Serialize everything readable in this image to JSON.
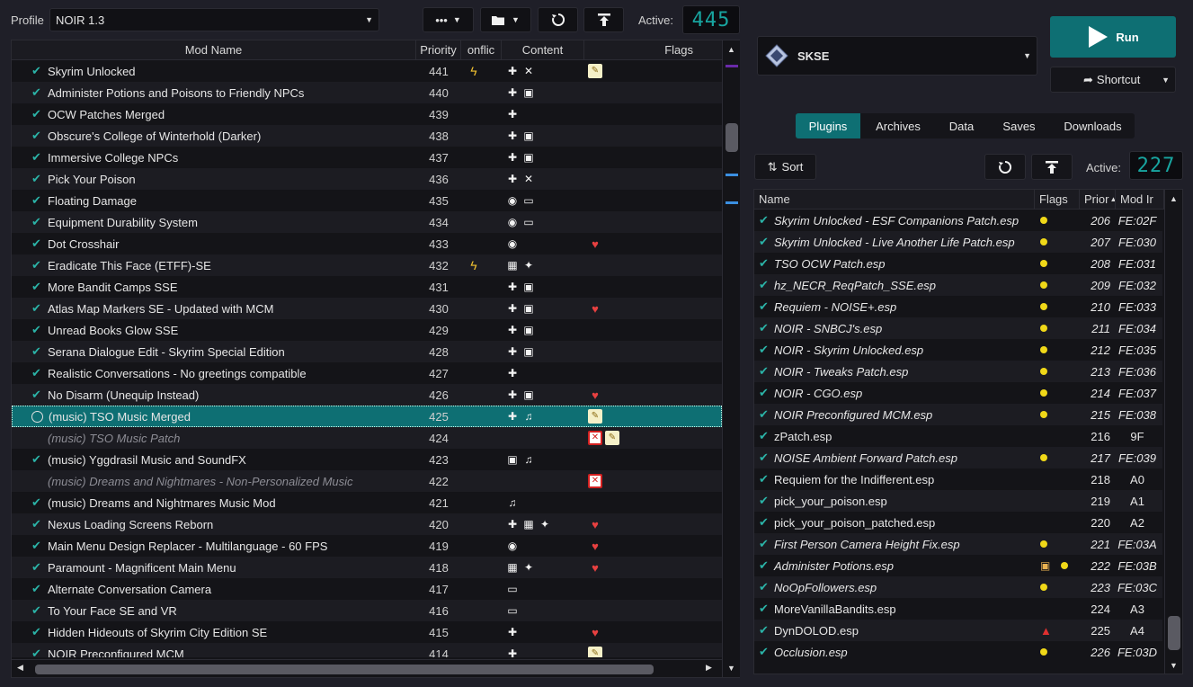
{
  "toolbar": {
    "profile_label": "Profile",
    "profile_value": "NOIR 1.3",
    "more_label": "•••",
    "active_label": "Active:",
    "active_count": "445"
  },
  "modlist": {
    "headers": [
      "Mod Name",
      "Priority",
      "onflic",
      "Content",
      "Flags"
    ],
    "rows": [
      {
        "state": "checked",
        "name": "Skyrim Unlocked",
        "priority": "441",
        "conflict": "bolt",
        "content": [
          "puzzle",
          "tools"
        ],
        "flags": [
          "note"
        ]
      },
      {
        "state": "checked",
        "name": "Administer Potions and Poisons to Friendly NPCs",
        "priority": "440",
        "conflict": "",
        "content": [
          "puzzle",
          "box"
        ],
        "flags": []
      },
      {
        "state": "checked",
        "name": "OCW Patches Merged",
        "priority": "439",
        "conflict": "",
        "content": [
          "puzzle"
        ],
        "flags": []
      },
      {
        "state": "checked",
        "name": "Obscure's College of Winterhold (Darker)",
        "priority": "438",
        "conflict": "",
        "content": [
          "puzzle",
          "box"
        ],
        "flags": []
      },
      {
        "state": "checked",
        "name": "Immersive College NPCs",
        "priority": "437",
        "conflict": "",
        "content": [
          "puzzle",
          "box"
        ],
        "flags": []
      },
      {
        "state": "checked",
        "name": "Pick Your Poison",
        "priority": "436",
        "conflict": "",
        "content": [
          "puzzle",
          "tools"
        ],
        "flags": []
      },
      {
        "state": "checked",
        "name": "Floating Damage",
        "priority": "435",
        "conflict": "",
        "content": [
          "skse",
          "ui"
        ],
        "flags": []
      },
      {
        "state": "checked",
        "name": "Equipment Durability System",
        "priority": "434",
        "conflict": "",
        "content": [
          "skse",
          "ui"
        ],
        "flags": []
      },
      {
        "state": "checked",
        "name": "Dot Crosshair",
        "priority": "433",
        "conflict": "",
        "content": [
          "skse"
        ],
        "flags": [
          "heart"
        ]
      },
      {
        "state": "checked",
        "name": "Eradicate This Face (ETFF)-SE",
        "priority": "432",
        "conflict": "bolt",
        "content": [
          "texture",
          "mesh"
        ],
        "flags": []
      },
      {
        "state": "checked",
        "name": "More Bandit Camps SSE",
        "priority": "431",
        "conflict": "",
        "content": [
          "puzzle",
          "box"
        ],
        "flags": []
      },
      {
        "state": "checked",
        "name": "Atlas Map Markers SE - Updated with MCM",
        "priority": "430",
        "conflict": "",
        "content": [
          "puzzle",
          "box"
        ],
        "flags": [
          "heart"
        ]
      },
      {
        "state": "checked",
        "name": "Unread Books Glow SSE",
        "priority": "429",
        "conflict": "",
        "content": [
          "puzzle",
          "box"
        ],
        "flags": []
      },
      {
        "state": "checked",
        "name": "Serana Dialogue Edit - Skyrim Special Edition",
        "priority": "428",
        "conflict": "",
        "content": [
          "puzzle",
          "box"
        ],
        "flags": []
      },
      {
        "state": "checked",
        "name": "Realistic Conversations - No greetings compatible",
        "priority": "427",
        "conflict": "",
        "content": [
          "puzzle"
        ],
        "flags": []
      },
      {
        "state": "checked",
        "name": "No Disarm (Unequip Instead)",
        "priority": "426",
        "conflict": "",
        "content": [
          "puzzle",
          "box"
        ],
        "flags": [
          "heart"
        ]
      },
      {
        "state": "selected",
        "name": "(music) TSO Music Merged",
        "priority": "425",
        "conflict": "",
        "content": [
          "puzzle",
          "music"
        ],
        "flags": [
          "note"
        ]
      },
      {
        "state": "disabled",
        "name": "(music) TSO Music Patch",
        "priority": "424",
        "conflict": "",
        "content": [],
        "flags": [
          "err",
          "note"
        ]
      },
      {
        "state": "checked",
        "name": "(music) Yggdrasil Music and SoundFX",
        "priority": "423",
        "conflict": "",
        "content": [
          "box",
          "music"
        ],
        "flags": []
      },
      {
        "state": "disabled",
        "name": "(music) Dreams and Nightmares - Non-Personalized Music",
        "priority": "422",
        "conflict": "",
        "content": [],
        "flags": [
          "err"
        ]
      },
      {
        "state": "checked",
        "name": "(music) Dreams and Nightmares Music Mod",
        "priority": "421",
        "conflict": "",
        "content": [
          "music"
        ],
        "flags": []
      },
      {
        "state": "checked",
        "name": "Nexus Loading Screens Reborn",
        "priority": "420",
        "conflict": "",
        "content": [
          "puzzle",
          "texture",
          "mesh"
        ],
        "flags": [
          "heart"
        ]
      },
      {
        "state": "checked",
        "name": "Main Menu Design Replacer - Multilanguage - 60 FPS",
        "priority": "419",
        "conflict": "",
        "content": [
          "skse"
        ],
        "flags": [
          "heart"
        ]
      },
      {
        "state": "checked",
        "name": "Paramount - Magnificent Main Menu",
        "priority": "418",
        "conflict": "",
        "content": [
          "texture",
          "mesh"
        ],
        "flags": [
          "heart"
        ]
      },
      {
        "state": "checked",
        "name": "Alternate Conversation Camera",
        "priority": "417",
        "conflict": "",
        "content": [
          "ui"
        ],
        "flags": []
      },
      {
        "state": "checked",
        "name": "To Your Face SE and VR",
        "priority": "416",
        "conflict": "",
        "content": [
          "ui"
        ],
        "flags": []
      },
      {
        "state": "checked",
        "name": "Hidden Hideouts of Skyrim City Edition SE",
        "priority": "415",
        "conflict": "",
        "content": [
          "puzzle"
        ],
        "flags": [
          "heart"
        ]
      },
      {
        "state": "checked",
        "name": "NOIR Preconfigured MCM",
        "priority": "414",
        "conflict": "",
        "content": [
          "puzzle"
        ],
        "flags": [
          "note"
        ]
      }
    ]
  },
  "executable": {
    "name": "SKSE",
    "run_label": "Run",
    "shortcut_label": "Shortcut"
  },
  "tabs": [
    "Plugins",
    "Archives",
    "Data",
    "Saves",
    "Downloads"
  ],
  "plugins_toolbar": {
    "sort_label": "Sort",
    "active_label": "Active:",
    "active_count": "227"
  },
  "plugins": {
    "headers": [
      "Name",
      "Flags",
      "Prior",
      "Mod Ir"
    ],
    "rows": [
      {
        "name": "Skyrim Unlocked - ESF Companions Patch.esp",
        "italic": true,
        "flags": [
          "dot"
        ],
        "priority": "206",
        "modindex": "FE:02F"
      },
      {
        "name": "Skyrim Unlocked - Live Another Life Patch.esp",
        "italic": true,
        "flags": [
          "dot"
        ],
        "priority": "207",
        "modindex": "FE:030"
      },
      {
        "name": "TSO OCW Patch.esp",
        "italic": true,
        "flags": [
          "dot"
        ],
        "priority": "208",
        "modindex": "FE:031"
      },
      {
        "name": "hz_NECR_ReqPatch_SSE.esp",
        "italic": true,
        "flags": [
          "dot"
        ],
        "priority": "209",
        "modindex": "FE:032"
      },
      {
        "name": "Requiem - NOISE+.esp",
        "italic": true,
        "flags": [
          "dot"
        ],
        "priority": "210",
        "modindex": "FE:033"
      },
      {
        "name": "NOIR - SNBCJ's.esp",
        "italic": true,
        "flags": [
          "dot"
        ],
        "priority": "211",
        "modindex": "FE:034"
      },
      {
        "name": "NOIR - Skyrim Unlocked.esp",
        "italic": true,
        "flags": [
          "dot"
        ],
        "priority": "212",
        "modindex": "FE:035"
      },
      {
        "name": "NOIR - Tweaks Patch.esp",
        "italic": true,
        "flags": [
          "dot"
        ],
        "priority": "213",
        "modindex": "FE:036"
      },
      {
        "name": "NOIR - CGO.esp",
        "italic": true,
        "flags": [
          "dot"
        ],
        "priority": "214",
        "modindex": "FE:037"
      },
      {
        "name": "NOIR Preconfigured MCM.esp",
        "italic": true,
        "flags": [
          "dot"
        ],
        "priority": "215",
        "modindex": "FE:038"
      },
      {
        "name": "zPatch.esp",
        "italic": false,
        "flags": [],
        "priority": "216",
        "modindex": "9F"
      },
      {
        "name": "NOISE Ambient Forward Patch.esp",
        "italic": true,
        "flags": [
          "dot"
        ],
        "priority": "217",
        "modindex": "FE:039"
      },
      {
        "name": "Requiem for the Indifferent.esp",
        "italic": false,
        "flags": [],
        "priority": "218",
        "modindex": "A0"
      },
      {
        "name": "pick_your_poison.esp",
        "italic": false,
        "flags": [],
        "priority": "219",
        "modindex": "A1"
      },
      {
        "name": "pick_your_poison_patched.esp",
        "italic": false,
        "flags": [],
        "priority": "220",
        "modindex": "A2"
      },
      {
        "name": "First Person Camera Height Fix.esp",
        "italic": true,
        "flags": [
          "dot"
        ],
        "priority": "221",
        "modindex": "FE:03A"
      },
      {
        "name": "Administer Potions.esp",
        "italic": true,
        "flags": [
          "box",
          "dot"
        ],
        "priority": "222",
        "modindex": "FE:03B"
      },
      {
        "name": "NoOpFollowers.esp",
        "italic": true,
        "flags": [
          "dot"
        ],
        "priority": "223",
        "modindex": "FE:03C"
      },
      {
        "name": "MoreVanillaBandits.esp",
        "italic": false,
        "flags": [],
        "priority": "224",
        "modindex": "A3"
      },
      {
        "name": "DynDOLOD.esp",
        "italic": false,
        "flags": [
          "warn"
        ],
        "priority": "225",
        "modindex": "A4"
      },
      {
        "name": "Occlusion.esp",
        "italic": true,
        "flags": [
          "dot"
        ],
        "priority": "226",
        "modindex": "FE:03D"
      }
    ]
  },
  "colors": {
    "accent": "#0e6f73",
    "check": "#2bb3a7",
    "lcd": "#18a5a0"
  }
}
